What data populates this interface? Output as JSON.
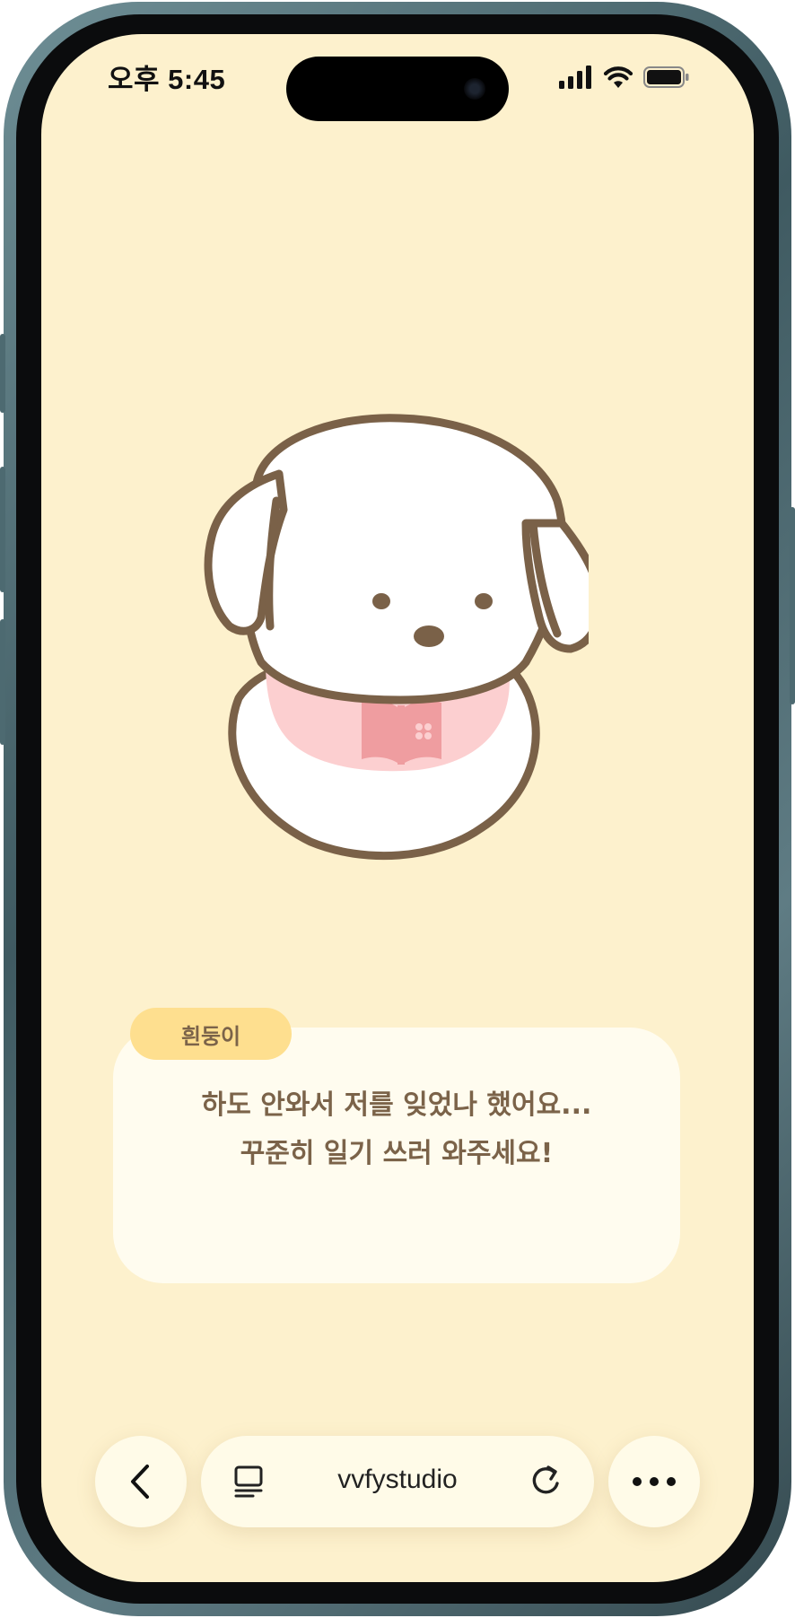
{
  "status_bar": {
    "time": "오후 5:45"
  },
  "character": {
    "name": "흰둥이"
  },
  "dialog": {
    "lines": [
      "하도 안와서 저를 잊었나 했어요...",
      "꾸준히 일기 쓰러 와주세요!"
    ]
  },
  "browser": {
    "url": "vvfystudio"
  },
  "icons": {
    "signal": "cellular-signal-icon",
    "wifi": "wifi-icon",
    "battery": "battery-icon",
    "back": "chevron-left-icon",
    "reader": "reader-mode-icon",
    "reload": "reload-icon",
    "more": "more-dots-icon",
    "bib": "open-book-clover-icon"
  },
  "colors": {
    "background": "#fdf1cd",
    "card": "#fffcef",
    "name_tag": "#fedf8f",
    "text": "#7b6349",
    "outline": "#7a6148",
    "bib": "#fccfd0",
    "bib_icon": "#ef9da0"
  }
}
